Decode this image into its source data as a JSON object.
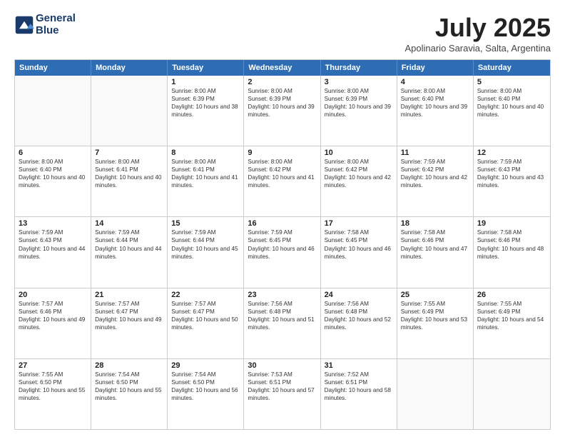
{
  "header": {
    "logo_line1": "General",
    "logo_line2": "Blue",
    "month_title": "July 2025",
    "subtitle": "Apolinario Saravia, Salta, Argentina"
  },
  "days_of_week": [
    "Sunday",
    "Monday",
    "Tuesday",
    "Wednesday",
    "Thursday",
    "Friday",
    "Saturday"
  ],
  "weeks": [
    [
      {
        "day": "",
        "empty": true
      },
      {
        "day": "",
        "empty": true
      },
      {
        "day": "1",
        "sunrise": "8:00 AM",
        "sunset": "6:39 PM",
        "daylight": "10 hours and 38 minutes."
      },
      {
        "day": "2",
        "sunrise": "8:00 AM",
        "sunset": "6:39 PM",
        "daylight": "10 hours and 39 minutes."
      },
      {
        "day": "3",
        "sunrise": "8:00 AM",
        "sunset": "6:39 PM",
        "daylight": "10 hours and 39 minutes."
      },
      {
        "day": "4",
        "sunrise": "8:00 AM",
        "sunset": "6:40 PM",
        "daylight": "10 hours and 39 minutes."
      },
      {
        "day": "5",
        "sunrise": "8:00 AM",
        "sunset": "6:40 PM",
        "daylight": "10 hours and 40 minutes."
      }
    ],
    [
      {
        "day": "6",
        "sunrise": "8:00 AM",
        "sunset": "6:40 PM",
        "daylight": "10 hours and 40 minutes."
      },
      {
        "day": "7",
        "sunrise": "8:00 AM",
        "sunset": "6:41 PM",
        "daylight": "10 hours and 40 minutes."
      },
      {
        "day": "8",
        "sunrise": "8:00 AM",
        "sunset": "6:41 PM",
        "daylight": "10 hours and 41 minutes."
      },
      {
        "day": "9",
        "sunrise": "8:00 AM",
        "sunset": "6:42 PM",
        "daylight": "10 hours and 41 minutes."
      },
      {
        "day": "10",
        "sunrise": "8:00 AM",
        "sunset": "6:42 PM",
        "daylight": "10 hours and 42 minutes."
      },
      {
        "day": "11",
        "sunrise": "7:59 AM",
        "sunset": "6:42 PM",
        "daylight": "10 hours and 42 minutes."
      },
      {
        "day": "12",
        "sunrise": "7:59 AM",
        "sunset": "6:43 PM",
        "daylight": "10 hours and 43 minutes."
      }
    ],
    [
      {
        "day": "13",
        "sunrise": "7:59 AM",
        "sunset": "6:43 PM",
        "daylight": "10 hours and 44 minutes."
      },
      {
        "day": "14",
        "sunrise": "7:59 AM",
        "sunset": "6:44 PM",
        "daylight": "10 hours and 44 minutes."
      },
      {
        "day": "15",
        "sunrise": "7:59 AM",
        "sunset": "6:44 PM",
        "daylight": "10 hours and 45 minutes."
      },
      {
        "day": "16",
        "sunrise": "7:59 AM",
        "sunset": "6:45 PM",
        "daylight": "10 hours and 46 minutes."
      },
      {
        "day": "17",
        "sunrise": "7:58 AM",
        "sunset": "6:45 PM",
        "daylight": "10 hours and 46 minutes."
      },
      {
        "day": "18",
        "sunrise": "7:58 AM",
        "sunset": "6:46 PM",
        "daylight": "10 hours and 47 minutes."
      },
      {
        "day": "19",
        "sunrise": "7:58 AM",
        "sunset": "6:46 PM",
        "daylight": "10 hours and 48 minutes."
      }
    ],
    [
      {
        "day": "20",
        "sunrise": "7:57 AM",
        "sunset": "6:46 PM",
        "daylight": "10 hours and 49 minutes."
      },
      {
        "day": "21",
        "sunrise": "7:57 AM",
        "sunset": "6:47 PM",
        "daylight": "10 hours and 49 minutes."
      },
      {
        "day": "22",
        "sunrise": "7:57 AM",
        "sunset": "6:47 PM",
        "daylight": "10 hours and 50 minutes."
      },
      {
        "day": "23",
        "sunrise": "7:56 AM",
        "sunset": "6:48 PM",
        "daylight": "10 hours and 51 minutes."
      },
      {
        "day": "24",
        "sunrise": "7:56 AM",
        "sunset": "6:48 PM",
        "daylight": "10 hours and 52 minutes."
      },
      {
        "day": "25",
        "sunrise": "7:55 AM",
        "sunset": "6:49 PM",
        "daylight": "10 hours and 53 minutes."
      },
      {
        "day": "26",
        "sunrise": "7:55 AM",
        "sunset": "6:49 PM",
        "daylight": "10 hours and 54 minutes."
      }
    ],
    [
      {
        "day": "27",
        "sunrise": "7:55 AM",
        "sunset": "6:50 PM",
        "daylight": "10 hours and 55 minutes."
      },
      {
        "day": "28",
        "sunrise": "7:54 AM",
        "sunset": "6:50 PM",
        "daylight": "10 hours and 55 minutes."
      },
      {
        "day": "29",
        "sunrise": "7:54 AM",
        "sunset": "6:50 PM",
        "daylight": "10 hours and 56 minutes."
      },
      {
        "day": "30",
        "sunrise": "7:53 AM",
        "sunset": "6:51 PM",
        "daylight": "10 hours and 57 minutes."
      },
      {
        "day": "31",
        "sunrise": "7:52 AM",
        "sunset": "6:51 PM",
        "daylight": "10 hours and 58 minutes."
      },
      {
        "day": "",
        "empty": true
      },
      {
        "day": "",
        "empty": true
      }
    ]
  ]
}
